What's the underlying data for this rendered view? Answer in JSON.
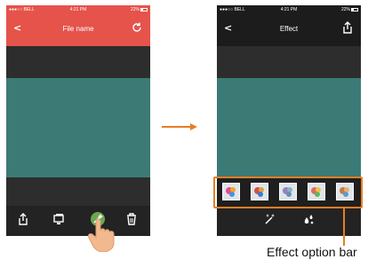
{
  "left_screen": {
    "status": {
      "carrier": "BELL",
      "time": "4:21 PM",
      "battery": "22%"
    },
    "nav": {
      "title": "File name",
      "back": "<"
    },
    "toolbar": [
      "share-icon",
      "slideshow-icon",
      "effect-wand-icon",
      "trash-icon"
    ]
  },
  "right_screen": {
    "status": {
      "carrier": "BELL",
      "time": "4:21 PM",
      "battery": "22%"
    },
    "nav": {
      "title": "Effect",
      "back": "<"
    },
    "effect_thumbnails": [
      "effect-1",
      "effect-2",
      "effect-3",
      "effect-4",
      "effect-5"
    ],
    "toolbar": [
      "magic-wand-icon",
      "drops-icon"
    ]
  },
  "callout": {
    "label": "Effect option bar"
  },
  "colors": {
    "accent": "#e5534b",
    "image": "#3c7a76",
    "highlight": "#e67e22"
  }
}
